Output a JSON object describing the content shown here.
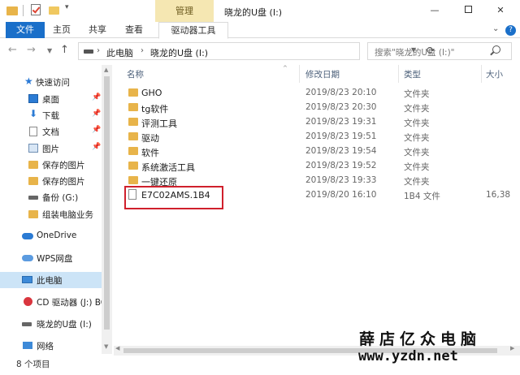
{
  "titlebar": {
    "context_tab": "管理",
    "window_title": "晓龙的U盘 (I:)",
    "minimize": "—",
    "close": "✕"
  },
  "ribbon": {
    "tabs": [
      "文件",
      "主页",
      "共享",
      "查看",
      "驱动器工具"
    ],
    "collapse": "⌄",
    "help": "?"
  },
  "address": {
    "crumbs": [
      "此电脑",
      "晓龙的U盘 (I:)"
    ],
    "separator": "›",
    "search_placeholder": "搜索\"晓龙的U盘 (I:)\""
  },
  "nav_pane": {
    "items": [
      {
        "label": "快速访问",
        "icon": "star-icon"
      },
      {
        "label": "桌面",
        "icon": "desktop-icon",
        "pinned": true
      },
      {
        "label": "下载",
        "icon": "download-icon",
        "pinned": true
      },
      {
        "label": "文档",
        "icon": "document-icon",
        "pinned": true
      },
      {
        "label": "图片",
        "icon": "pictures-icon",
        "pinned": true
      },
      {
        "label": "保存的图片",
        "icon": "folder-icon"
      },
      {
        "label": "保存的图片",
        "icon": "folder-icon"
      },
      {
        "label": "备份 (G:)",
        "icon": "drive-icon"
      },
      {
        "label": "组装电脑业务",
        "icon": "folder-icon"
      },
      {
        "label": "OneDrive",
        "icon": "onedrive-icon"
      },
      {
        "label": "WPS网盘",
        "icon": "wps-cloud-icon"
      },
      {
        "label": "此电脑",
        "icon": "this-pc-icon",
        "selected": true
      },
      {
        "label": "CD 驱动器 (J:) BC",
        "icon": "cd-drive-icon"
      },
      {
        "label": "晓龙的U盘 (I:)",
        "icon": "usb-drive-icon"
      },
      {
        "label": "网络",
        "icon": "network-icon"
      }
    ],
    "pin_glyph": "📌"
  },
  "file_list": {
    "columns": [
      "名称",
      "修改日期",
      "类型",
      "大小"
    ],
    "rows": [
      {
        "name": "GHO",
        "date": "2019/8/23 20:10",
        "type": "文件夹",
        "size": "",
        "kind": "folder"
      },
      {
        "name": "tg软件",
        "date": "2019/8/23 20:30",
        "type": "文件夹",
        "size": "",
        "kind": "folder"
      },
      {
        "name": "评测工具",
        "date": "2019/8/23 19:31",
        "type": "文件夹",
        "size": "",
        "kind": "folder"
      },
      {
        "name": "驱动",
        "date": "2019/8/23 19:51",
        "type": "文件夹",
        "size": "",
        "kind": "folder"
      },
      {
        "name": "软件",
        "date": "2019/8/23 19:54",
        "type": "文件夹",
        "size": "",
        "kind": "folder"
      },
      {
        "name": "系统激活工具",
        "date": "2019/8/23 19:52",
        "type": "文件夹",
        "size": "",
        "kind": "folder"
      },
      {
        "name": "一键还原",
        "date": "2019/8/23 19:33",
        "type": "文件夹",
        "size": "",
        "kind": "folder"
      },
      {
        "name": "E7C02AMS.1B4",
        "date": "2019/8/20 16:10",
        "type": "1B4 文件",
        "size": "16,38",
        "kind": "file"
      }
    ]
  },
  "status": {
    "item_count": "8 个项目"
  },
  "watermark": {
    "title": "薛店亿众电脑",
    "url": "www.yzdn.net"
  },
  "colors": {
    "accent": "#1a6fc9",
    "context_tab": "#f5e7b2",
    "selection": "#cce4f7",
    "highlight_box": "#d0202c",
    "folder": "#e8b44a"
  }
}
